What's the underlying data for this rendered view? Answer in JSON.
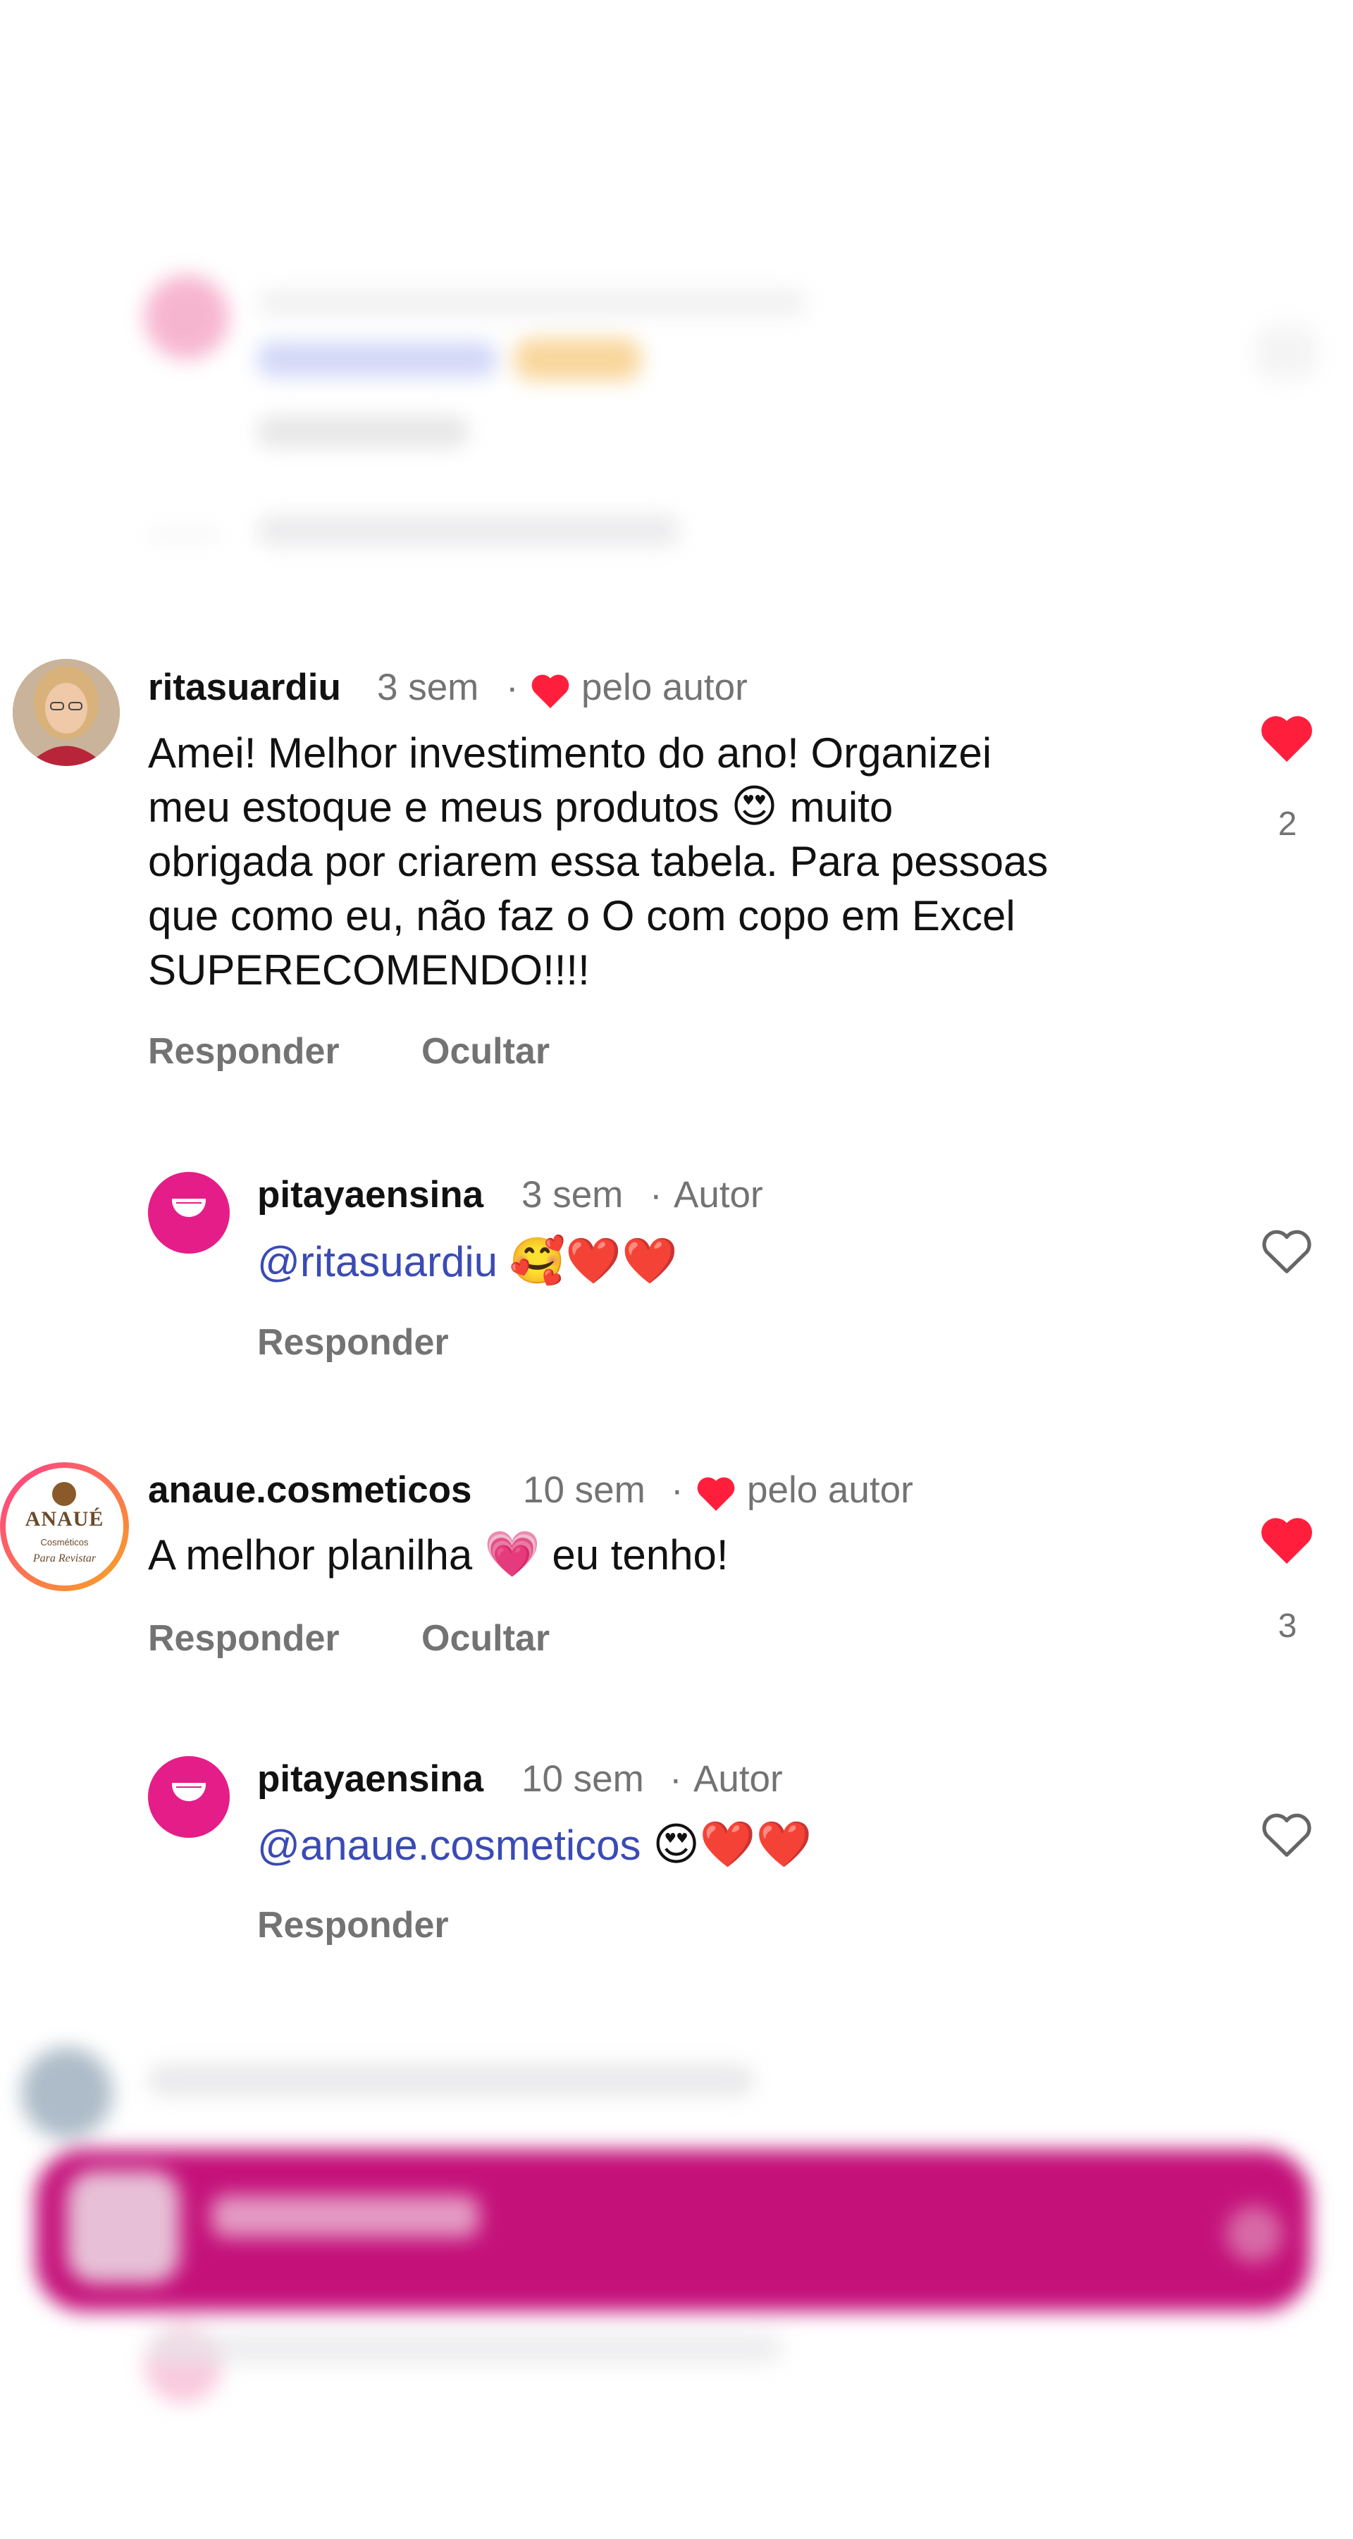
{
  "comments": [
    {
      "username": "ritasuardiu",
      "time": "3 sem",
      "sep": "·",
      "liked_by_author": "pelo autor",
      "text_lines": [
        "Amei! Melhor investimento do ano! Organizei",
        "meu estoque e meus produtos",
        "muito",
        "obrigada por criarem essa tabela. Para pessoas",
        "que como eu, não faz o O com copo em Excel",
        "SUPERECOMENDO!!!!"
      ],
      "emoji": "😍",
      "reply_label": "Responder",
      "hide_label": "Ocultar",
      "like_count": "2",
      "liked": true,
      "reply": {
        "username": "pitayaensina",
        "time": "3 sem",
        "sep": "·",
        "author_tag": "Autor",
        "mention": "@ritasuardiu",
        "emojis": "🥰❤️❤️",
        "reply_label": "Responder",
        "liked": false
      }
    },
    {
      "username": "anaue.cosmeticos",
      "time": "10 sem",
      "sep": "·",
      "liked_by_author": "pelo autor",
      "text_before": "A melhor planilha",
      "emoji": "💗",
      "text_after": "eu tenho!",
      "reply_label": "Responder",
      "hide_label": "Ocultar",
      "like_count": "3",
      "liked": true,
      "avatar_brand": "ANAUÉ",
      "avatar_sub": "Cosméticos",
      "avatar_script": "Para Revistar",
      "reply": {
        "username": "pitayaensina",
        "time": "10 sem",
        "sep": "·",
        "author_tag": "Autor",
        "mention": "@anaue.cosmeticos",
        "emojis": "😍❤️❤️",
        "reply_label": "Responder",
        "liked": false
      }
    }
  ],
  "colors": {
    "heart_red": "#ff1f3d",
    "mention_blue": "#3a4bb5",
    "muted_gray": "#737373",
    "brand_pink": "#e51d88"
  },
  "icons": [
    "heart-filled-icon",
    "heart-outline-icon"
  ]
}
